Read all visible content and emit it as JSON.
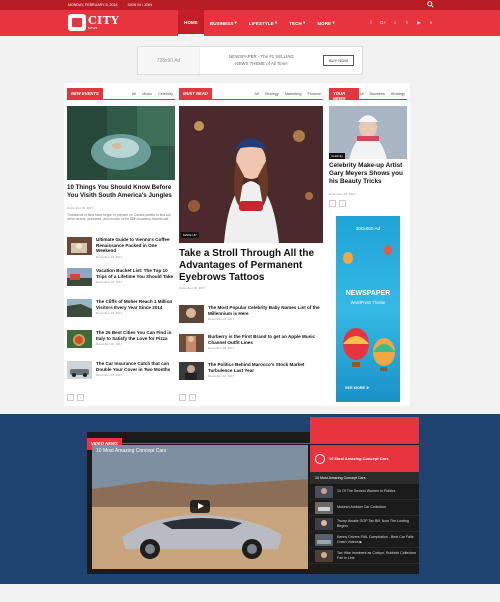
{
  "topbar": {
    "date": "MONDAY, FEBRUARY 5, 2018",
    "signin": "SIGN IN / JOIN"
  },
  "logo": {
    "name": "CITY",
    "sub": "NEWS"
  },
  "nav": [
    "HOME",
    "BUSINESS",
    "LIFESTYLE",
    "TECH",
    "MORE"
  ],
  "social_icons": [
    "f",
    "G+",
    "i",
    "t",
    "▶",
    "v"
  ],
  "ad": {
    "size": "728x90 Ad",
    "line1": "NEWSPAPER - The #1 SELLING",
    "line2": "NEWS THEME of All Time!",
    "btn": "BUY NOW"
  },
  "col1": {
    "tag": "NEW EVENTS",
    "filters": [
      "All",
      "Music",
      "Celebrity"
    ],
    "main": {
      "title": "10 Things You Should Know Before You Visith South America's Jungles",
      "date": "December 18, 2017",
      "excerpt": "Thousands of fans have begun to prepare for Oscars parties to find out which actors, actresses, and movies of the 88th Academy Awards will..."
    },
    "items": [
      {
        "title": "Ultimate Guide to Vienna's Coffee Renaissance Packed in One Weekend",
        "date": "December 18, 2017"
      },
      {
        "title": "Vacation Bucket List: The Top 10 Trips of a Lifetime You Should Take",
        "date": "December 18, 2017"
      },
      {
        "title": "The Cliffs of Moher Reach 1 Million Visitors Every Year Since 2014",
        "date": "December 18, 2017"
      },
      {
        "title": "The 25 Best Cities You Can Find in Italy to Satisfy the Love for Pizza",
        "date": "December 18, 2017"
      },
      {
        "title": "The Car Insurance Catch that can Double Your Cover in Two Months",
        "date": "December 18, 2017"
      }
    ]
  },
  "col2": {
    "tag": "MUST READ",
    "filters": [
      "All",
      "Strategy",
      "Marketing",
      "Finance"
    ],
    "badge": "MAKE UP",
    "main": {
      "title": "Take a Stroll Through All the Advantages of Permanent Eyebrows Tattoos",
      "date": "December 18, 2017"
    },
    "items": [
      {
        "title": "The Most Popular Celebrity Baby Names List of the Millennium is Here",
        "date": "December 18, 2017"
      },
      {
        "title": "Burberry is the First Brand to get an Apple Music Channel Outfit Lines",
        "date": "December 18, 2017"
      },
      {
        "title": "The Politics Behind Marocco's Stock Market Turbulence Last Year",
        "date": "December 18, 2017"
      }
    ]
  },
  "col3": {
    "tag": "YOUR NEWS",
    "filters": [
      "All",
      "Business",
      "Strategy"
    ],
    "badge": "Celebrity",
    "main": {
      "title": "Celebrity Make-up Artist Gary Meyers Shows you his Beauty Tricks",
      "date": "December 18, 2017"
    },
    "ad": {
      "size": "300x600 Ad",
      "name": "NEWSPAPER",
      "sub": "WordPress Theme",
      "more": "SEE MORE ➤"
    }
  },
  "pager": [
    "‹",
    "›"
  ],
  "video": {
    "tag": "VIDEO NEWS",
    "player_title": "10 Most Amazing Concept Cars",
    "playlist_title": "10 Most Amazing Concept Cars",
    "current": "10 Most Amazing Concept Cars",
    "items": [
      "10 Of The Sexiest Women In Politics",
      "Mukesh Ambani Car Collection",
      "Trump Awaits GOP Tax Bill, Now The Looting Begins",
      "Kenny Drivers FAIL Compilation - Best Car Fails Crash Videos ▶",
      "Tax Hike Imminent as Corbyn, Rubbish Collectors Fall In Line"
    ]
  },
  "colors": {
    "brand": "#e8343f",
    "topbar": "#b81d26",
    "video_bg": "#1e4572"
  }
}
